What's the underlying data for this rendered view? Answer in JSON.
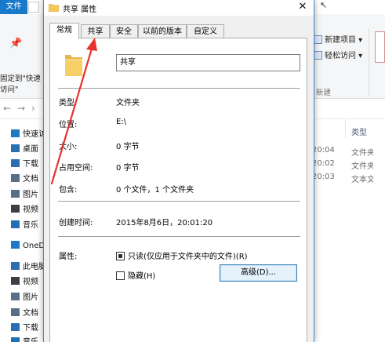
{
  "explorer": {
    "file_tab": "文件",
    "pin_label": "固定到\"快速访问\"",
    "ribbon_items": [
      {
        "label": "新建项目 ▾"
      },
      {
        "label": "轻松访问 ▾"
      }
    ],
    "group_label": "新建",
    "column_header": "类型",
    "tree": [
      {
        "label": "快速访",
        "icon": "star-icon",
        "color": "#1e78c8"
      },
      {
        "label": "桌面",
        "icon": "desktop-icon",
        "color": "#2a6fb0"
      },
      {
        "label": "下载",
        "icon": "download-icon",
        "color": "#2a6fb0"
      },
      {
        "label": "文档",
        "icon": "document-icon",
        "color": "#5a6f86"
      },
      {
        "label": "图片",
        "icon": "picture-icon",
        "color": "#5a6f86"
      },
      {
        "label": "视频",
        "icon": "video-icon",
        "color": "#3a3f48"
      },
      {
        "label": "音乐",
        "icon": "music-icon",
        "color": "#1f6fb6"
      },
      {
        "label": "OneD",
        "icon": "cloud-icon",
        "color": "#1e78c8"
      },
      {
        "label": "此电脑",
        "icon": "computer-icon",
        "color": "#2a6fb0"
      },
      {
        "label": "视频",
        "icon": "video-icon",
        "color": "#3a3f48"
      },
      {
        "label": "图片",
        "icon": "picture-icon",
        "color": "#5a6f86"
      },
      {
        "label": "文档",
        "icon": "document-icon",
        "color": "#5a6f86"
      },
      {
        "label": "下载",
        "icon": "download-icon",
        "color": "#2a6fb0"
      },
      {
        "label": "音乐",
        "icon": "music-icon",
        "color": "#1f6fb6"
      }
    ],
    "rows": [
      {
        "time": "20:04",
        "type": "文件夹"
      },
      {
        "time": "20:02",
        "type": "文件夹"
      },
      {
        "time": "20:03",
        "type": "文本文档"
      }
    ]
  },
  "dialog": {
    "title": "共享 属性",
    "close_label": "✕",
    "tabs": [
      {
        "label": "常规",
        "active": true
      },
      {
        "label": "共享",
        "active": false
      },
      {
        "label": "安全",
        "active": false
      },
      {
        "label": "以前的版本",
        "active": false
      },
      {
        "label": "自定义",
        "active": false
      }
    ],
    "name_value": "共享",
    "fields": [
      {
        "label": "类型:",
        "value": "文件夹"
      },
      {
        "label": "位置:",
        "value": "E:\\"
      },
      {
        "label": "大小:",
        "value": "0 字节"
      },
      {
        "label": "占用空间:",
        "value": "0 字节"
      },
      {
        "label": "包含:",
        "value": "0 个文件，1 个文件夹"
      }
    ],
    "created": {
      "label": "创建时间:",
      "value": "2015年8月6日，20:01:20"
    },
    "attributes": {
      "label": "属性:",
      "readonly": "只读(仅应用于文件夹中的文件)(R)",
      "hidden": "隐藏(H)",
      "advanced": "高级(D)..."
    }
  },
  "colors": {
    "accent": "#1979ca",
    "folder": "#f5c85a",
    "annotation": "#e8322f"
  }
}
